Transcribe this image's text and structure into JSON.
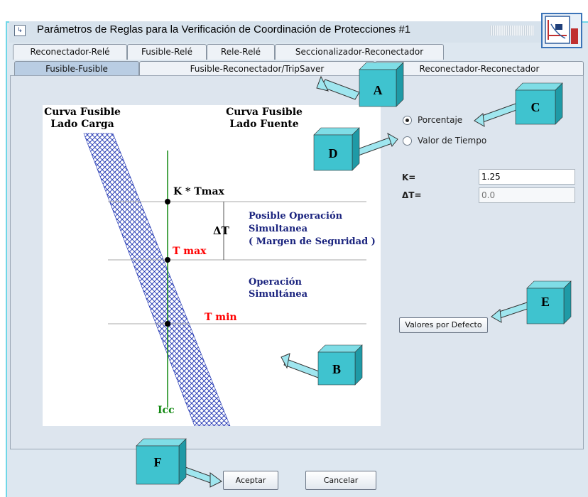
{
  "window": {
    "title": "Parámetros de Reglas para la Verificación de Coordinación de Protecciones #1"
  },
  "tabs": {
    "row1": [
      "Reconectador-Relé",
      "Fusible-Relé",
      "Rele-Relé",
      "Seccionalizador-Reconectador"
    ],
    "row2": [
      "Fusible-Fusible",
      "Fusible-Reconectador/TripSaver",
      "Reconectador-Reconectador"
    ]
  },
  "diagram": {
    "curve_load_line1": "Curva Fusible",
    "curve_load_line2": "Lado Carga",
    "curve_source_line1": "Curva Fusible",
    "curve_source_line2": "Lado Fuente",
    "k_tmax": "K * Tmax",
    "delta_t": "ΔT",
    "tmax": "T max",
    "tmin": "T min",
    "possible_line1": "Posible Operación",
    "possible_line2": "Simultanea",
    "possible_line3": "( Margen de Seguridad )",
    "simultaneous_line1": "Operación",
    "simultaneous_line2": "Simultánea",
    "icc": "Icc"
  },
  "options": {
    "percent_label": "Porcentaje",
    "time_value_label": "Valor de Tiempo",
    "selected": "Porcentaje"
  },
  "fields": {
    "k_label": "K=",
    "k_value": "1.25",
    "dt_label": "ΔT=",
    "dt_placeholder": "0.0"
  },
  "buttons": {
    "defaults": "Valores por Defecto",
    "accept": "Aceptar",
    "cancel": "Cancelar"
  },
  "callouts": [
    "A",
    "B",
    "C",
    "D",
    "E",
    "F"
  ],
  "colors": {
    "frame": "#dde5ee",
    "callout_cube": "#3fc3cf",
    "arrow_fill": "#9fe6ef",
    "red_text": "#ff0000",
    "navy_text": "#1a237e",
    "green_line": "#118811"
  }
}
